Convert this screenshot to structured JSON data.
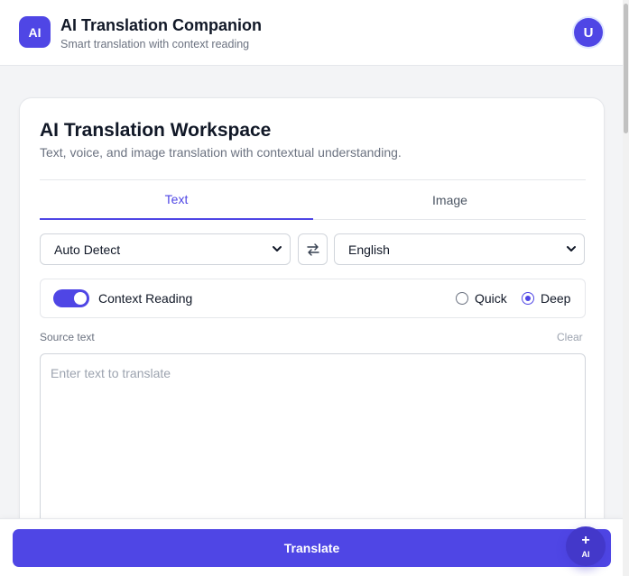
{
  "header": {
    "logo_text": "AI",
    "title": "AI Translation Companion",
    "subtitle": "Smart translation with context reading",
    "avatar_initial": "U"
  },
  "workspace": {
    "title": "AI Translation Workspace",
    "subtitle": "Text, voice, and image translation with contextual understanding.",
    "tabs": [
      {
        "label": "Text",
        "active": true
      },
      {
        "label": "Image",
        "active": false
      }
    ],
    "source_language": "Auto Detect",
    "target_language": "English",
    "swap_icon": "swap-arrows-icon",
    "context": {
      "label": "Context Reading",
      "enabled": true,
      "modes": [
        {
          "label": "Quick",
          "selected": false
        },
        {
          "label": "Deep",
          "selected": true
        }
      ]
    },
    "source": {
      "label": "Source text",
      "clear_label": "Clear",
      "placeholder": "Enter text to translate",
      "value": ""
    }
  },
  "footer": {
    "translate_label": "Translate",
    "fab_icon": "plus-icon",
    "fab_text": "AI"
  },
  "colors": {
    "accent": "#4f46e5",
    "fab": "#4338ca"
  }
}
